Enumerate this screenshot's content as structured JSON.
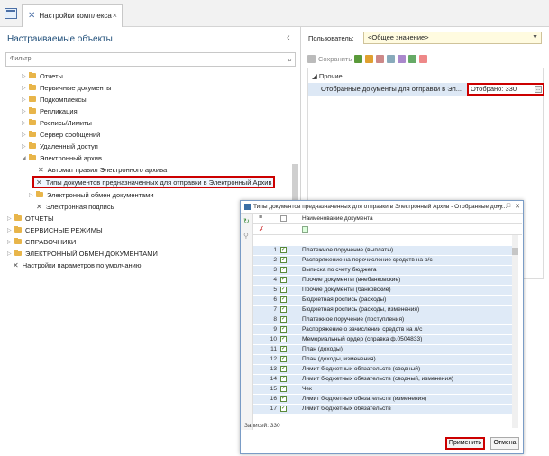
{
  "tab": {
    "title": "Настройки комплекса"
  },
  "left": {
    "title": "Настраиваемые объекты",
    "filter_placeholder": "Фильтр",
    "tree": [
      "Отчеты",
      "Первичные документы",
      "Подкомплексы",
      "Репликация",
      "Роспись/Лимиты",
      "Сервер сообщений",
      "Удаленный доступ",
      "Электронный архив",
      "Автомат правил Электронного архива",
      "Типы документов предназначенных для отправки в Электронный Архив",
      "Электронный обмен документами",
      "Электронная подпись",
      "ОТЧЕТЫ",
      "СЕРВИСНЫЕ РЕЖИМЫ",
      "СПРАВОЧНИКИ",
      "ЭЛЕКТРОННЫЙ ОБМЕН ДОКУМЕНТАМИ",
      "Настройки параметров по умолчанию"
    ]
  },
  "right": {
    "users_label": "Пользователь:",
    "users_value": "<Общее значение>",
    "save_label": "Сохранить",
    "group": "Прочие",
    "prop_name": "Отобранные документы для отправки в Эл...",
    "prop_value": "Отобрано: 330"
  },
  "dialog": {
    "title": "Типы документов предназначенных для отправки в Электронный Архив - Отобранные доку...",
    "col_name": "Наименование документа",
    "rows": [
      "Платежное поручение (выплаты)",
      "Распоряжение на перечисление средств на р/с",
      "Выписка по счету бюджета",
      "Прочие документы (внебанковские)",
      "Прочие документы (банковские)",
      "Бюджетная роспись (расходы)",
      "Бюджетная роспись (расходы, изменения)",
      "Платежное поручение (поступления)",
      "Распоряжение о зачислении средств на л/с",
      "Мемориальный ордер (справка ф.0504833)",
      "План (доходы)",
      "План (доходы, изменения)",
      "Лимит бюджетных обязательств (сводный)",
      "Лимит бюджетных обязательств (сводный, изменения)",
      "Чек",
      "Лимит бюджетных обязательств (изменения)",
      "Лимит бюджетных обязательств"
    ],
    "records": "Записей: 330",
    "apply": "Применить",
    "cancel": "Отмена"
  }
}
